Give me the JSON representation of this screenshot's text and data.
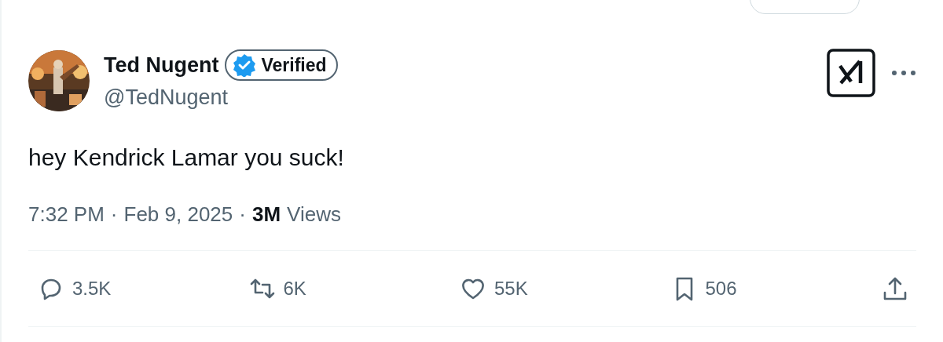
{
  "post": {
    "author": {
      "name": "Ted Nugent",
      "badge": "Verified",
      "handle": "@TedNugent"
    },
    "text": "hey Kendrick Lamar you suck!",
    "meta": {
      "time": "7:32 PM",
      "separator_1": "·",
      "date": "Feb 9, 2025",
      "separator_2": "·",
      "views_count": "3M",
      "views_label": "Views"
    },
    "actions": [
      {
        "kind": "reply",
        "count": "3.5K"
      },
      {
        "kind": "repost",
        "count": "6K"
      },
      {
        "kind": "like",
        "count": "55K"
      },
      {
        "kind": "bookmark",
        "count": "506"
      },
      {
        "kind": "share"
      }
    ]
  }
}
